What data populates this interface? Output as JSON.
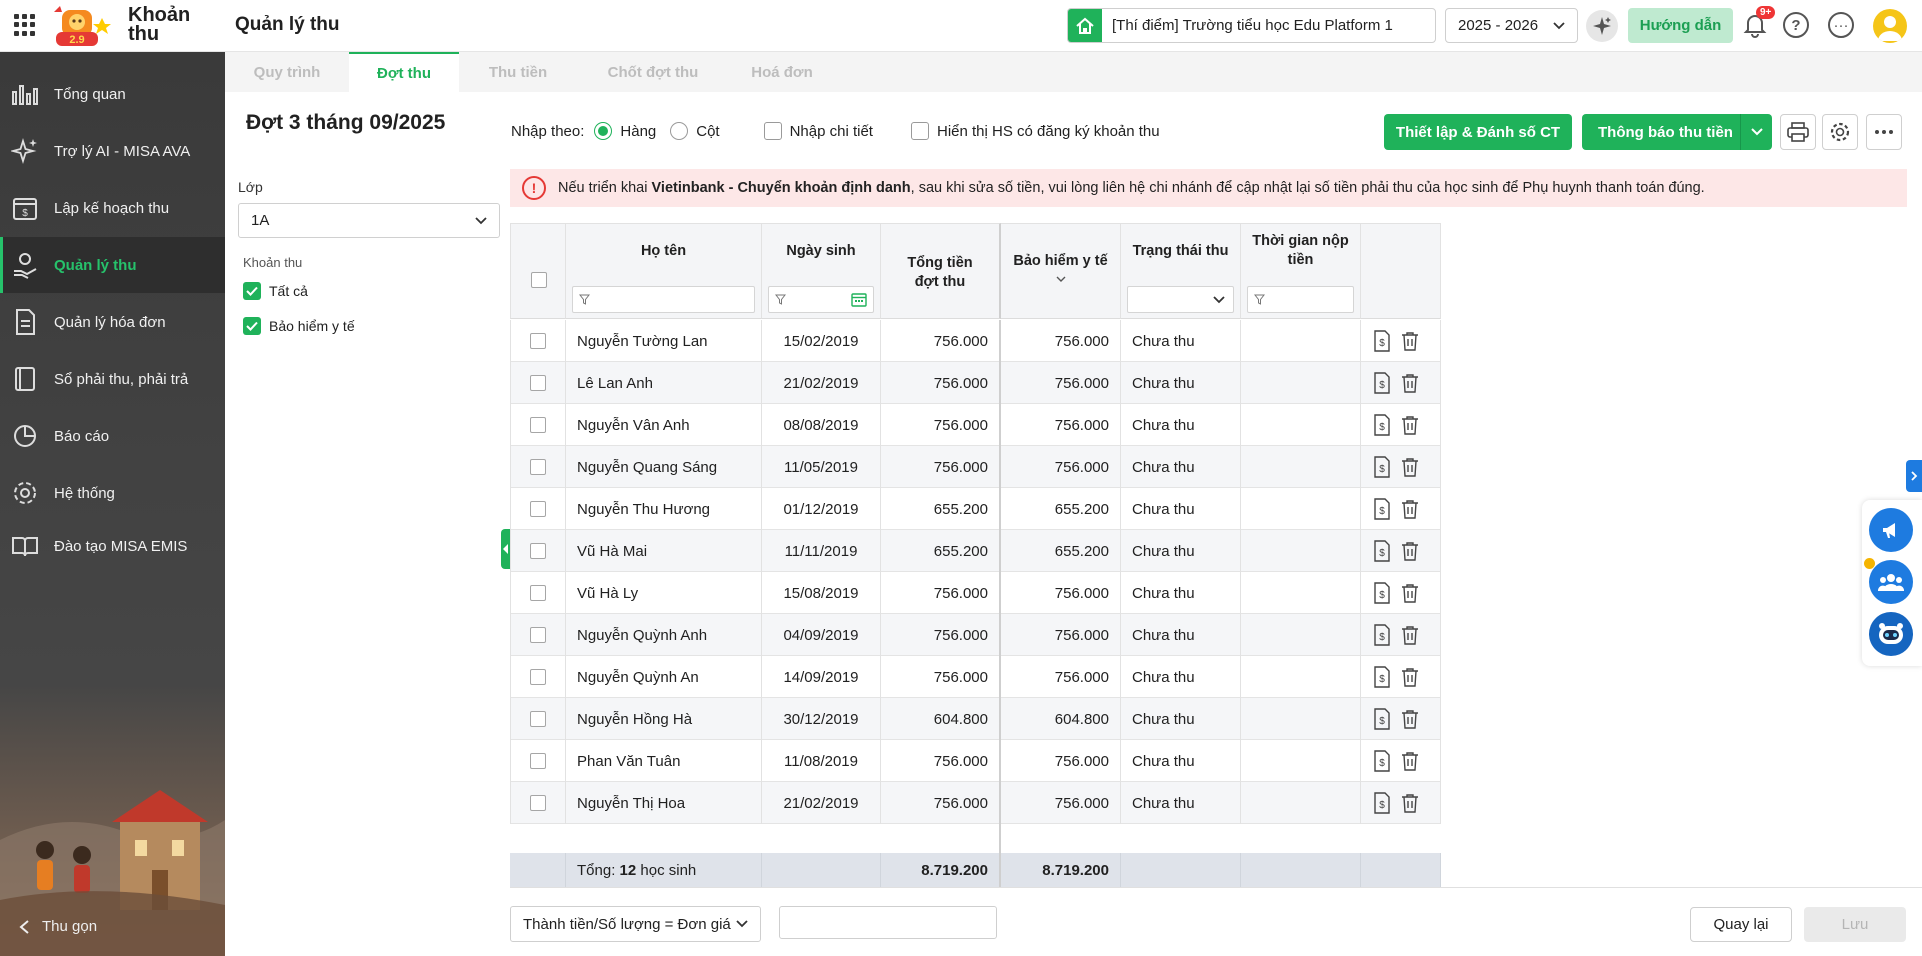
{
  "header": {
    "app_name_line1": "Khoản",
    "app_name_line2": "thu",
    "page_title": "Quản lý thu",
    "school": "[Thí điểm] Trường tiểu học Edu Platform 1",
    "school_year": "2025 - 2026",
    "help_label": "Hướng dẫn",
    "notification_badge": "9+",
    "question_glyph": "?",
    "more_glyph": "···",
    "logo_badge": "2.9"
  },
  "sidebar": {
    "items": [
      {
        "label": "Tổng quan",
        "icon": "bar-chart-icon"
      },
      {
        "label": "Trợ lý AI - MISA AVA",
        "icon": "sparkle-icon"
      },
      {
        "label": "Lập kế hoạch thu",
        "icon": "calendar-money-icon"
      },
      {
        "label": "Quản lý thu",
        "icon": "hand-coin-icon"
      },
      {
        "label": "Quản lý hóa đơn",
        "icon": "invoice-icon"
      },
      {
        "label": "Sổ phải thu, phải trả",
        "icon": "ledger-icon"
      },
      {
        "label": "Báo cáo",
        "icon": "pie-chart-icon"
      },
      {
        "label": "Hệ thống",
        "icon": "gear-icon"
      },
      {
        "label": "Đào tạo MISA EMIS",
        "icon": "book-open-icon"
      }
    ],
    "active_index": 3,
    "collapse_label": "Thu gọn"
  },
  "tabs": [
    {
      "label": "Quy trình"
    },
    {
      "label": "Đợt thu"
    },
    {
      "label": "Thu tiền"
    },
    {
      "label": "Chốt đợt thu"
    },
    {
      "label": "Hoá đơn"
    }
  ],
  "filter": {
    "batch_title": "Đợt 3 tháng 09/2025",
    "class_label": "Lớp",
    "class_value": "1A",
    "fee_label": "Khoản thu",
    "fee_options": [
      "Tất cả",
      "Bảo hiểm y tế"
    ]
  },
  "options": {
    "input_by_label": "Nhập theo:",
    "row_label": "Hàng",
    "column_label": "Cột",
    "detail_label": "Nhập chi tiết",
    "show_registered_label": "Hiển thị HS có đăng ký khoản thu"
  },
  "actions": {
    "setup_label": "Thiết lập & Đánh số CT",
    "notify_label": "Thông báo thu tiền"
  },
  "alert": {
    "text_before": "Nếu triển khai ",
    "bold": "Vietinbank - Chuyển khoản định danh",
    "text_after": ", sau khi sửa số tiền, vui lòng liên hệ chi nhánh để cập nhật lại số tiền phải thu của học sinh để Phụ huynh thanh toán đúng.",
    "icon_glyph": "!"
  },
  "table": {
    "columns": {
      "name": "Họ tên",
      "dob": "Ngày sinh",
      "total_line1": "Tổng tiền",
      "total_line2": "đợt thu",
      "insurance": "Bảo hiểm y tế",
      "status": "Trạng thái thu",
      "paid_time_line1": "Thời gian nộp",
      "paid_time_line2": "tiền"
    },
    "rows": [
      {
        "name": "Nguyễn Tường Lan",
        "dob": "15/02/2019",
        "total": "756.000",
        "insurance": "756.000",
        "status": "Chưa thu"
      },
      {
        "name": "Lê Lan Anh",
        "dob": "21/02/2019",
        "total": "756.000",
        "insurance": "756.000",
        "status": "Chưa thu"
      },
      {
        "name": "Nguyễn Vân Anh",
        "dob": "08/08/2019",
        "total": "756.000",
        "insurance": "756.000",
        "status": "Chưa thu"
      },
      {
        "name": "Nguyễn Quang Sáng",
        "dob": "11/05/2019",
        "total": "756.000",
        "insurance": "756.000",
        "status": "Chưa thu"
      },
      {
        "name": "Nguyễn Thu Hương",
        "dob": "01/12/2019",
        "total": "655.200",
        "insurance": "655.200",
        "status": "Chưa thu"
      },
      {
        "name": "Vũ Hà Mai",
        "dob": "11/11/2019",
        "total": "655.200",
        "insurance": "655.200",
        "status": "Chưa thu"
      },
      {
        "name": "Vũ Hà Ly",
        "dob": "15/08/2019",
        "total": "756.000",
        "insurance": "756.000",
        "status": "Chưa thu"
      },
      {
        "name": "Nguyễn Quỳnh Anh",
        "dob": "04/09/2019",
        "total": "756.000",
        "insurance": "756.000",
        "status": "Chưa thu"
      },
      {
        "name": "Nguyễn Quỳnh An",
        "dob": "14/09/2019",
        "total": "756.000",
        "insurance": "756.000",
        "status": "Chưa thu"
      },
      {
        "name": "Nguyễn Hồng Hà",
        "dob": "30/12/2019",
        "total": "604.800",
        "insurance": "604.800",
        "status": "Chưa thu"
      },
      {
        "name": "Phan Văn Tuân",
        "dob": "11/08/2019",
        "total": "756.000",
        "insurance": "756.000",
        "status": "Chưa thu"
      },
      {
        "name": "Nguyễn Thị Hoa",
        "dob": "21/02/2019",
        "total": "756.000",
        "insurance": "756.000",
        "status": "Chưa thu"
      }
    ],
    "total_label": "Tổng:",
    "total_count": "12",
    "total_unit": "học sinh",
    "total_amount": "8.719.200",
    "total_insurance": "8.719.200"
  },
  "bottom": {
    "formula": "Thành tiền/Số lượng = Đơn giá",
    "formula_input": "",
    "back_label": "Quay lại",
    "save_label": "Lưu"
  },
  "colors": {
    "primary": "#1fb25a",
    "sidebar_bg": "#3a3a3a",
    "alert_bg": "#fde7e7",
    "accent_blue": "#1e7be0"
  }
}
